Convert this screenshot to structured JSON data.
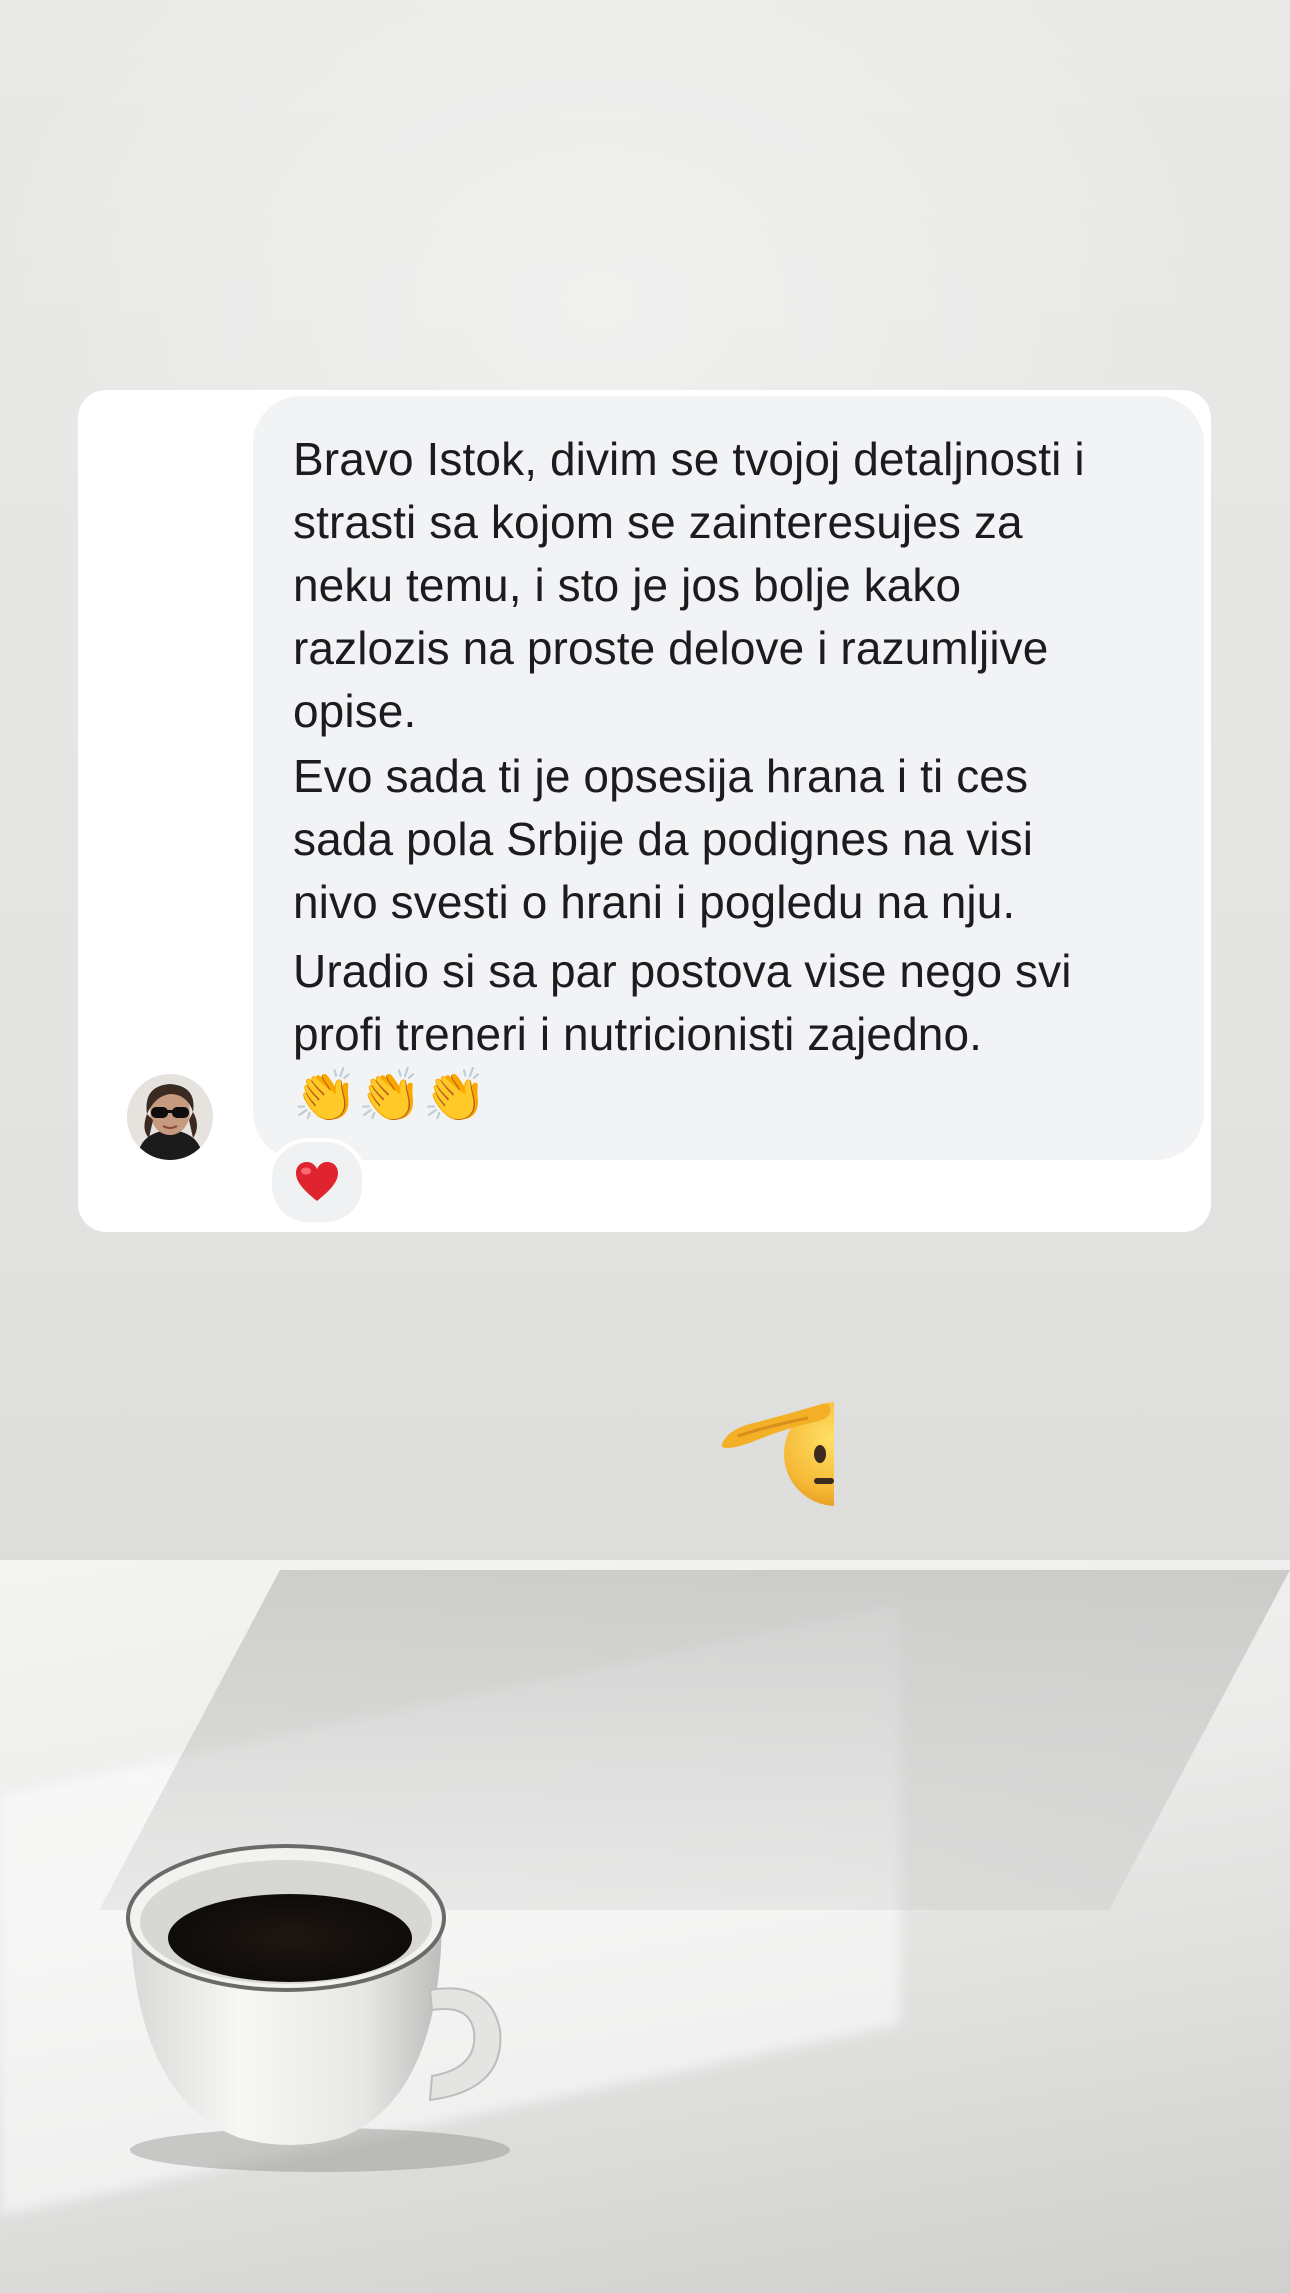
{
  "message": {
    "paragraphs": [
      "Bravo Istok, divim se tvojoj detaljnosti i\nstrasti sa kojom se zainteresujes za\nneku temu, i sto je jos bolje kako\nrazlozis na proste delove i razumljive\nopise.",
      "Evo sada ti je opsesija hrana i ti ces\nsada pola Srbije da podignes na visi\nnivo svesti o hrani i pogledu na nju.",
      "Uradio si sa par postova vise nego svi\nprofi treneri i nutricionisti zajedno."
    ],
    "emoji_line": "👏👏👏",
    "reaction": "❤️"
  },
  "sticker": {
    "emoji": "🫡"
  },
  "icons": {
    "avatar": "profile-photo",
    "reaction": "heart-icon",
    "claps": "clapping-hands-icon",
    "sticker": "saluting-face-icon",
    "background": "coffee-cup-photo"
  },
  "colors": {
    "bubble": "#f2f3f5",
    "card": "#ffffff",
    "text": "#1c1c1e",
    "heart": "#e0242f"
  }
}
